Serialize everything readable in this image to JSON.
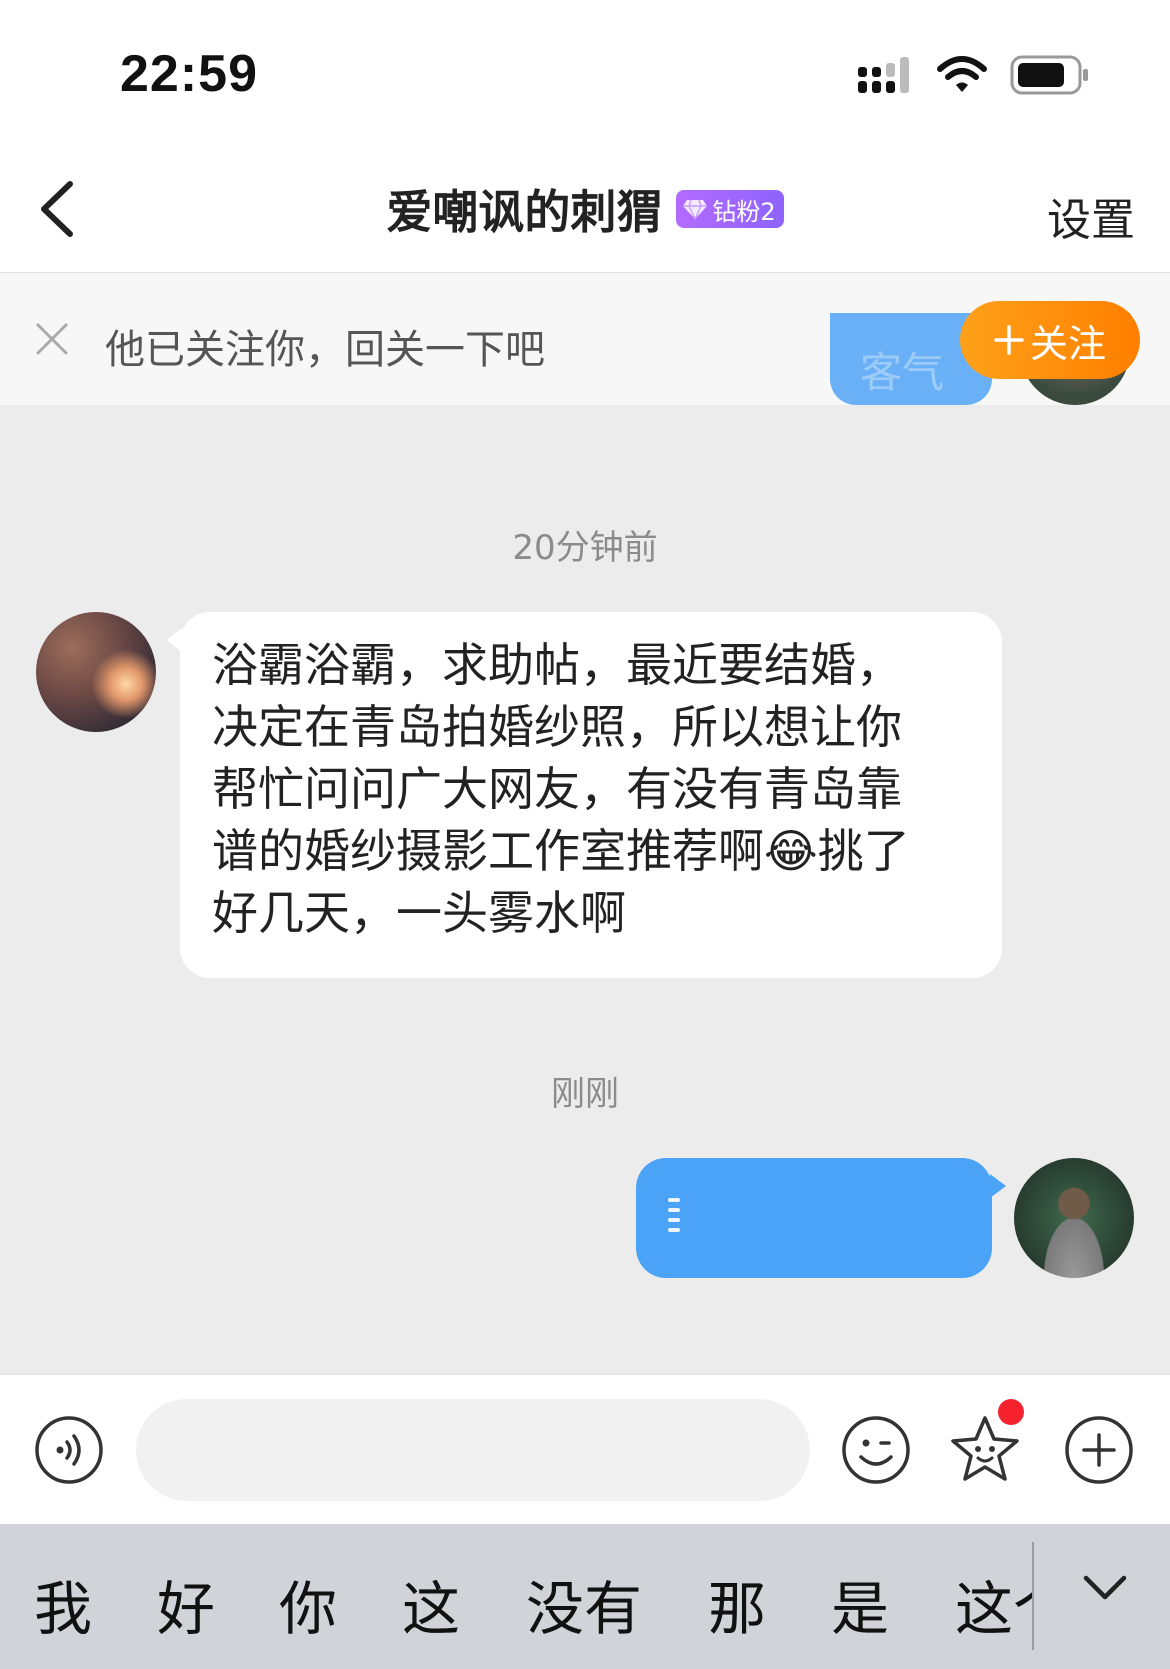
{
  "status_bar": {
    "time": "22:59"
  },
  "nav": {
    "title": "爱嘲讽的刺猬",
    "badge": "钻粉2",
    "settings": "设置"
  },
  "follow_bar": {
    "text": "他已关注你，回关一下吧",
    "button": "关注",
    "ghost_text": "客气"
  },
  "chat": {
    "timestamp_1": "20分钟前",
    "incoming": {
      "line1": "浴霸浴霸，求助帖，最近要结婚，",
      "line2": "决定在青岛拍婚纱照，所以想让你",
      "line3": "帮忙问问广大网友，有没有青岛靠",
      "line4a": "谱的婚纱摄影工作室推荐啊",
      "emoji": "😂",
      "line4b": "挑了",
      "line5": "好几天，一头雾水啊"
    },
    "timestamp_2": "刚刚"
  },
  "input": {
    "placeholder": ""
  },
  "keyboard": {
    "candidates": [
      "我",
      "好",
      "你",
      "这",
      "没有",
      "那",
      "是",
      "这个"
    ]
  },
  "colors": {
    "accent_orange": "#ff8a00",
    "bubble_blue": "#4aa3f7",
    "badge_purple": "#9a66ff",
    "notification_red": "#f5222d"
  }
}
